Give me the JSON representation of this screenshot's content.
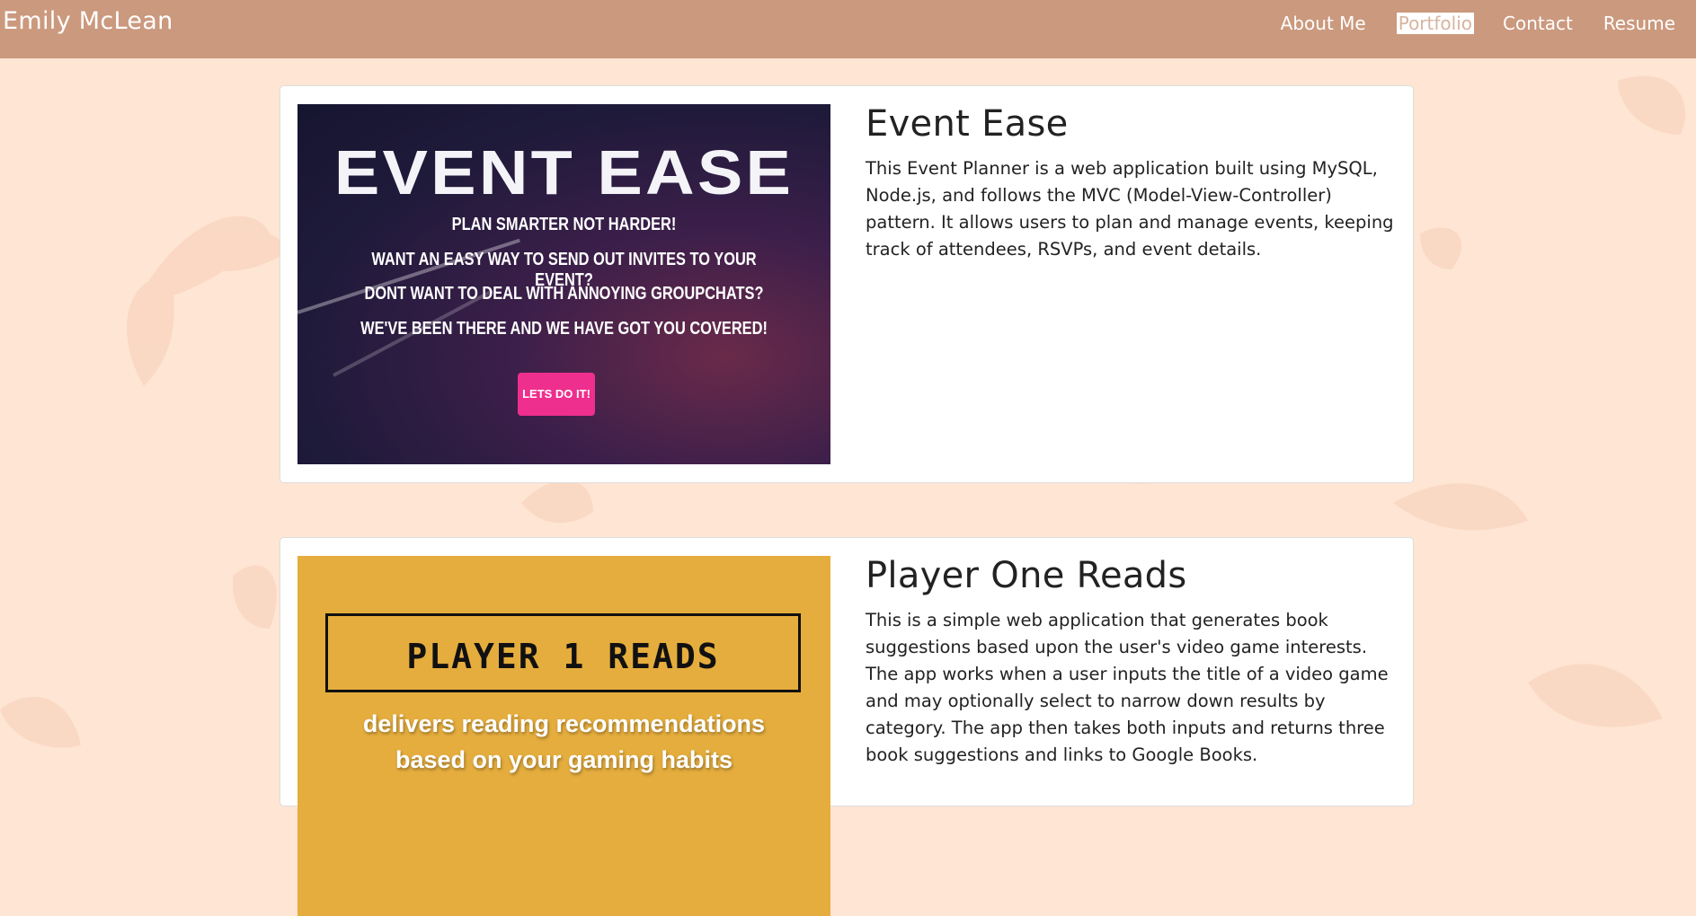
{
  "nav": {
    "brand": "Emily McLean",
    "links": [
      {
        "label": "About Me"
      },
      {
        "label": "Portfolio"
      },
      {
        "label": "Contact"
      },
      {
        "label": "Resume"
      }
    ],
    "active_link": "Portfolio"
  },
  "projects": [
    {
      "title": "Event Ease",
      "description": "This Event Planner is a web application built using MySQL, Node.js, and follows the MVC (Model-View-Controller) pattern. It allows users to plan and manage events, keeping track of attendees, RSVPs, and event details.",
      "image": {
        "headline": "EVENT EASE",
        "lines": [
          "PLAN SMARTER NOT HARDER!",
          "WANT AN EASY WAY TO SEND OUT INVITES TO YOUR EVENT?",
          "DONT WANT TO DEAL WITH ANNOYING GROUPCHATS?",
          "WE'VE BEEN THERE AND WE HAVE GOT YOU COVERED!"
        ],
        "button": "LETS DO IT!"
      }
    },
    {
      "title": "Player One Reads",
      "description": "This is a simple web application that generates book suggestions based upon the user's video game interests. The app works when a user inputs the title of a video game and may optionally select to narrow down results by category. The app then takes both inputs and returns three book suggestions and links to Google Books.",
      "image": {
        "logo": "PLAYER 1 READS",
        "tagline": "delivers reading recommendations",
        "tagline2": "based on your gaming habits"
      }
    }
  ],
  "colors": {
    "background": "#FFE5D4",
    "navbar": "#CB997E",
    "cta": "#EE2F8D",
    "por_bg": "#E5AD3D"
  }
}
